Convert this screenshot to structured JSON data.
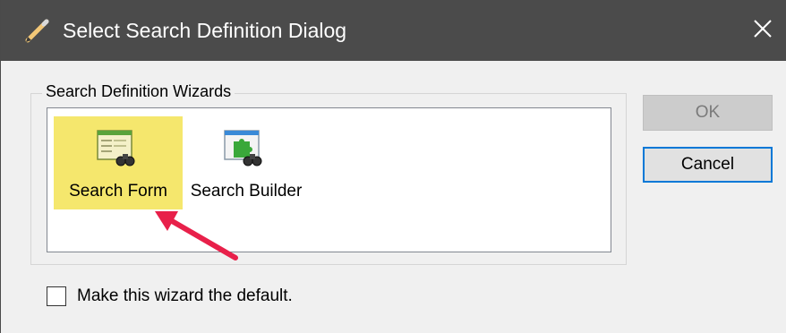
{
  "window": {
    "title": "Select Search Definition Dialog",
    "title_icon": "pencil-icon",
    "close_icon": "close-icon"
  },
  "group": {
    "label": "Search Definition Wizards",
    "items": [
      {
        "label": "Search Form",
        "icon": "search-form-icon",
        "selected": true
      },
      {
        "label": "Search Builder",
        "icon": "search-builder-icon",
        "selected": false
      }
    ]
  },
  "buttons": {
    "ok_label": "OK",
    "ok_enabled": false,
    "cancel_label": "Cancel"
  },
  "checkbox": {
    "label": "Make this wizard the default.",
    "checked": false
  },
  "annotation": {
    "arrow_color": "#e8204a"
  },
  "colors": {
    "titlebar": "#4b4b4b",
    "selection_highlight": "#f5e76d",
    "focus_border": "#0078d7"
  }
}
